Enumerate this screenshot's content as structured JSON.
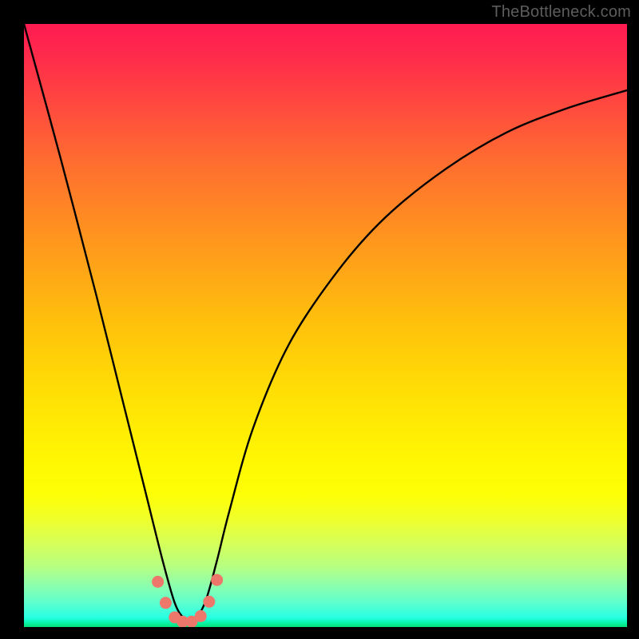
{
  "watermark": "TheBottleneck.com",
  "chart_data": {
    "type": "line",
    "title": "",
    "xlabel": "",
    "ylabel": "",
    "x_range": [
      0,
      100
    ],
    "y_range": [
      0,
      100
    ],
    "series": [
      {
        "name": "bottleneck-curve",
        "x": [
          0,
          6,
          12,
          16,
          20,
          23,
          25,
          26.5,
          28,
          30,
          32,
          34,
          38,
          44,
          52,
          60,
          70,
          80,
          90,
          100
        ],
        "values": [
          100,
          78,
          55,
          39,
          23,
          11,
          4,
          1.5,
          1,
          4,
          11,
          19,
          33,
          47,
          59,
          68,
          76,
          82,
          86,
          89
        ]
      }
    ],
    "markers": {
      "name": "highlight-points",
      "color": "#ed776b",
      "x": [
        22.2,
        23.5,
        25.0,
        26.3,
        27.8,
        29.3,
        30.7,
        32.0
      ],
      "values": [
        7.5,
        4.0,
        1.6,
        0.9,
        0.9,
        1.8,
        4.2,
        7.8
      ]
    },
    "gradient_stops": [
      {
        "pos": 0.0,
        "color": "#ff1b51"
      },
      {
        "pos": 0.5,
        "color": "#ffbf0c"
      },
      {
        "pos": 0.78,
        "color": "#fdff06"
      },
      {
        "pos": 1.0,
        "color": "#06e176"
      }
    ]
  }
}
